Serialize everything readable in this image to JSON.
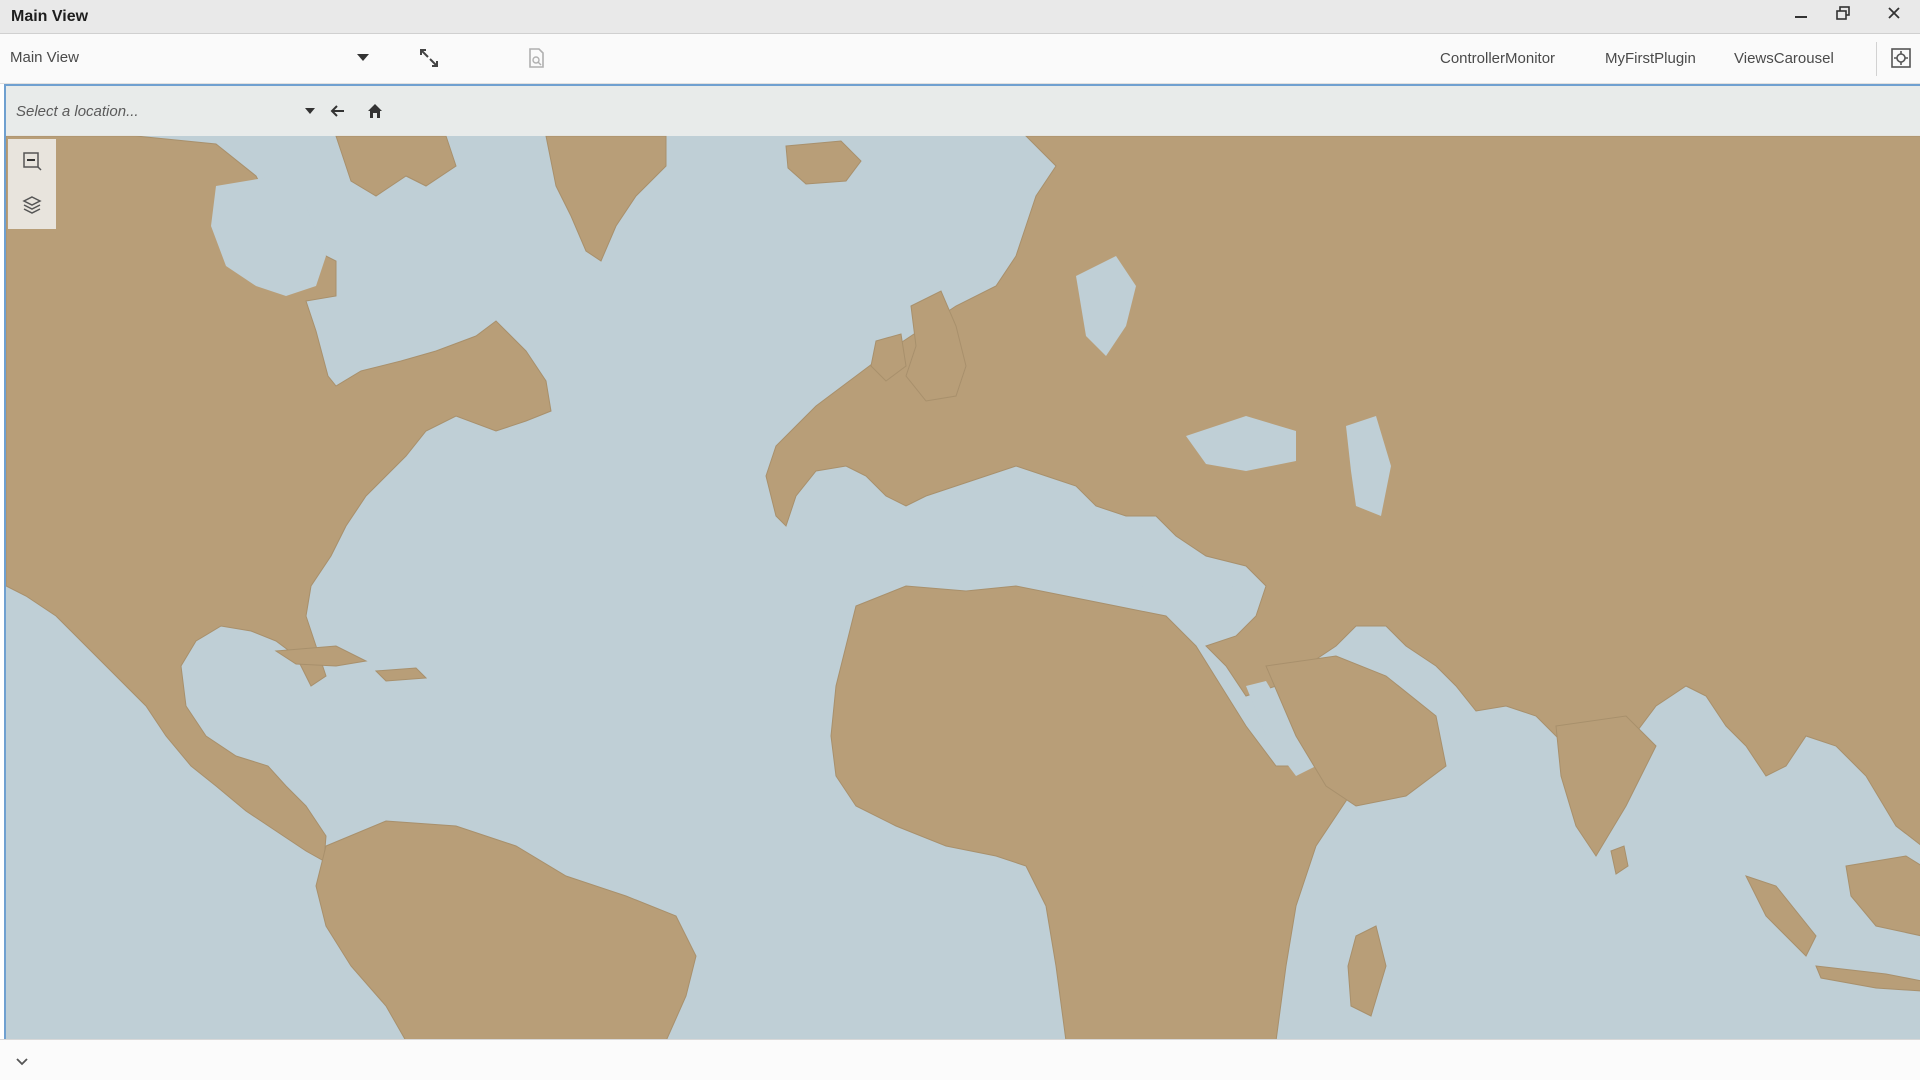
{
  "window": {
    "title": "Main View"
  },
  "toolbar": {
    "view_selector_value": "Main View",
    "plugins": [
      "ControllerMonitor",
      "MyFirstPlugin",
      "ViewsCarousel"
    ]
  },
  "map": {
    "location_placeholder": "Select a location...",
    "colors": {
      "land": "#b89e78",
      "water": "#bfcfd6",
      "selection_border": "#6fa0d0"
    }
  },
  "icons": {
    "minimize": "minimize-icon",
    "restore": "restore-icon",
    "close": "close-icon",
    "link": "link-icon",
    "document": "document-icon",
    "settings": "window-settings-icon",
    "back": "back-arrow-icon",
    "home": "home-icon",
    "zoom": "zoom-icon",
    "layers": "layers-icon",
    "expand": "chevron-down-icon"
  }
}
